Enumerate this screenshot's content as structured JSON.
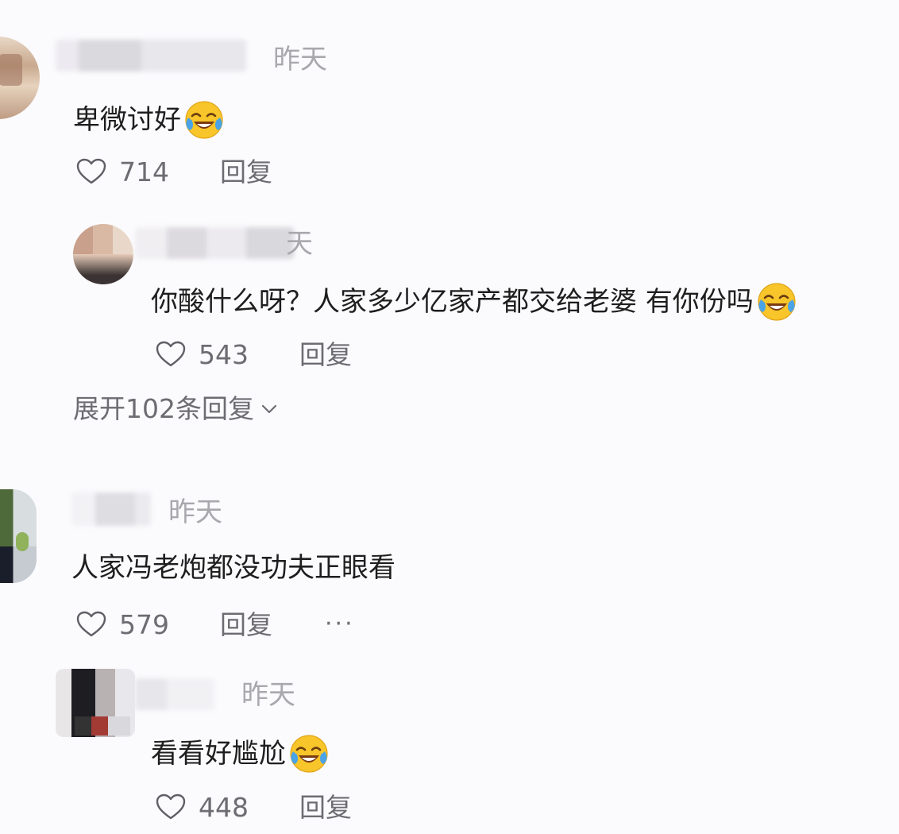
{
  "comments": [
    {
      "time": "昨天",
      "text": "卑微讨好",
      "emoji": "crying-laughing-emoji",
      "likes": "714",
      "reply_label": "回复",
      "replies": [
        {
          "time_partial": "天",
          "text": "你酸什么呀？人家多少亿家产都交给老婆 有你份吗",
          "emoji": "crying-laughing-emoji",
          "likes": "543",
          "reply_label": "回复"
        }
      ],
      "expand_label": "展开102条回复"
    },
    {
      "time": "昨天",
      "text": "人家冯老炮都没功夫正眼看",
      "likes": "579",
      "reply_label": "回复",
      "more_label": "···",
      "replies": [
        {
          "time": "昨天",
          "text": "看看好尴尬",
          "emoji": "crying-laughing-emoji",
          "likes": "448",
          "reply_label": "回复"
        }
      ]
    }
  ],
  "colors": {
    "background": "#fbfbfd",
    "text": "#1e1e1e",
    "secondary": "#6c6c72",
    "time": "#a8a8ad",
    "emoji_face": "#f7c325"
  }
}
